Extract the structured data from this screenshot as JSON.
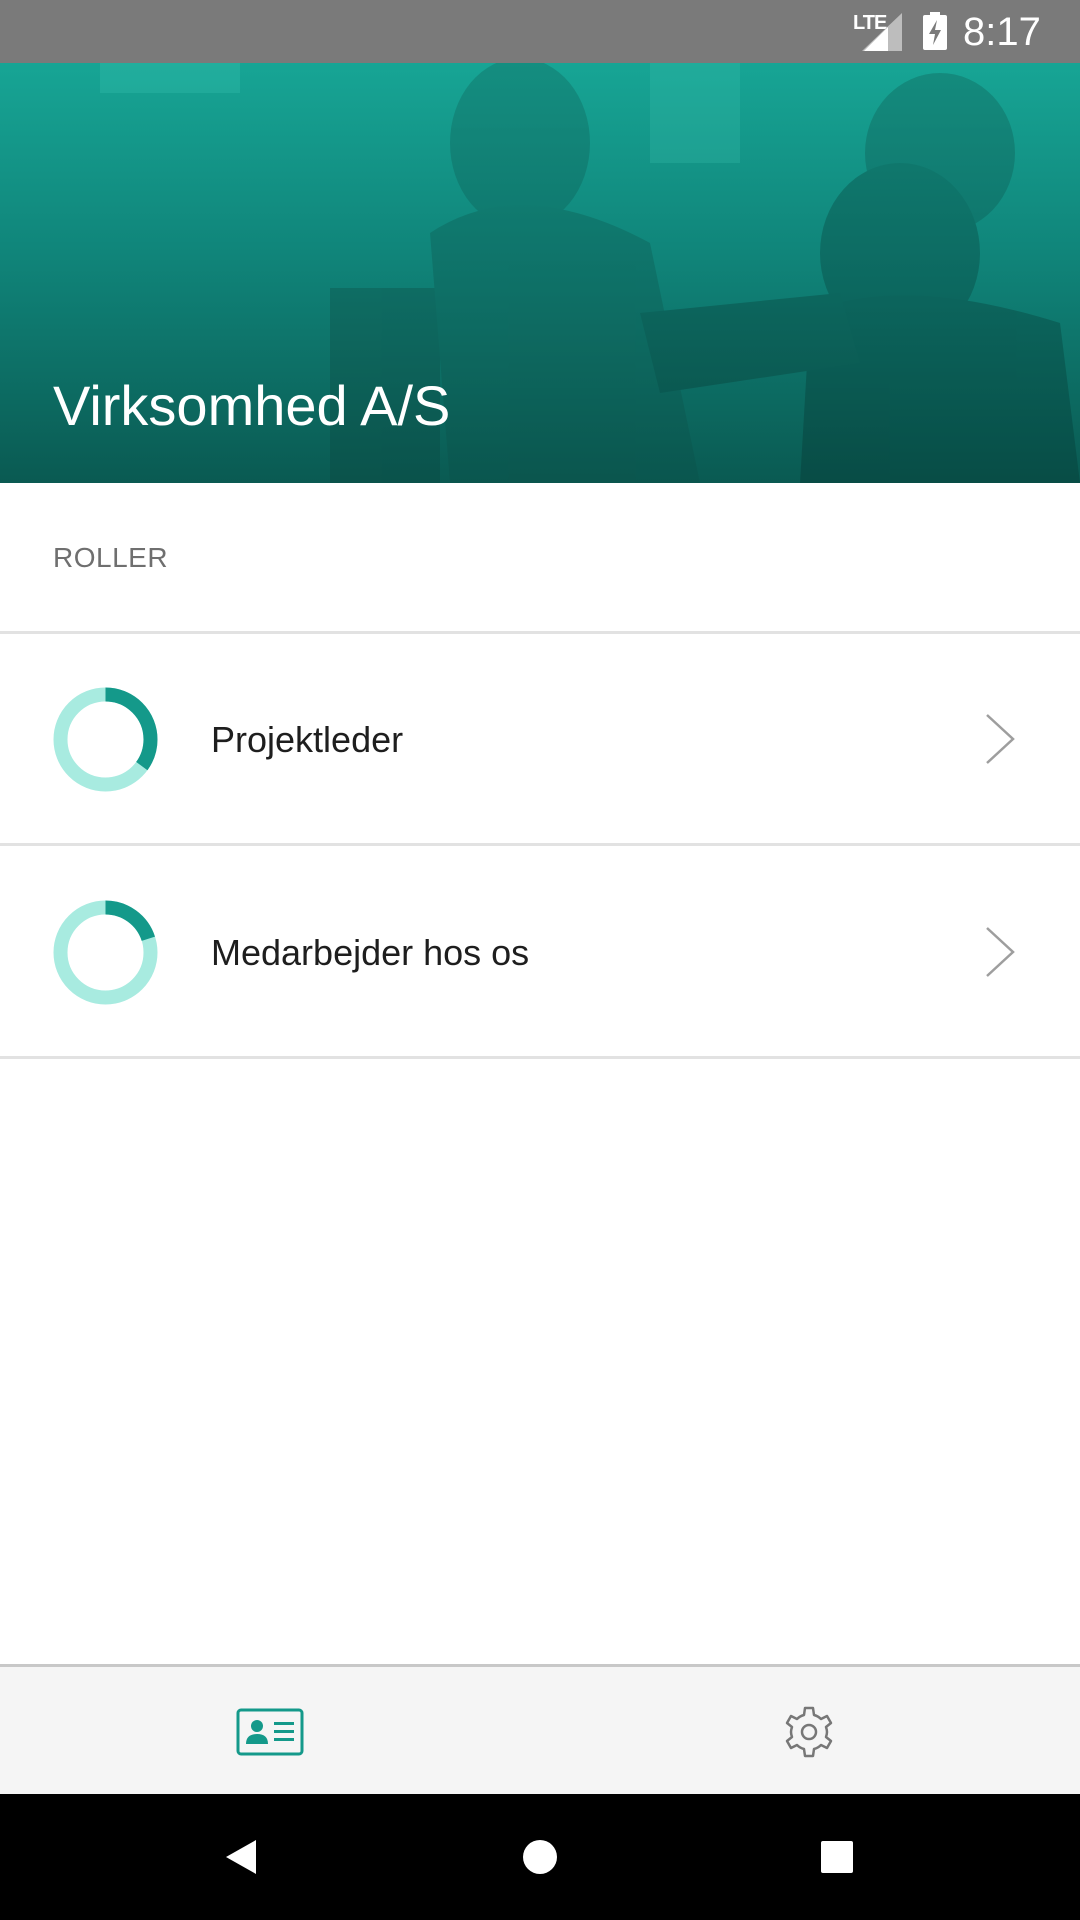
{
  "status_bar": {
    "network_label": "LTE",
    "time": "8:17",
    "icons": [
      "lte-signal-icon",
      "battery-charging-icon"
    ]
  },
  "header": {
    "company_name": "Virksomhed A/S",
    "background_color": "#10857a"
  },
  "section": {
    "label": "ROLLER"
  },
  "roles": [
    {
      "label": "Projektleder",
      "progress": 0.35
    },
    {
      "label": "Medarbejder hos os",
      "progress": 0.2
    }
  ],
  "colors": {
    "accent": "#14998a",
    "donut_track": "#a8ebe0",
    "chevron": "#9e9e9e"
  },
  "bottom_nav": {
    "items": [
      {
        "icon": "profile-card-icon",
        "active": true
      },
      {
        "icon": "gear-icon",
        "active": false
      }
    ]
  },
  "system_nav": {
    "icons": [
      "back-icon",
      "home-icon",
      "recents-icon"
    ]
  }
}
